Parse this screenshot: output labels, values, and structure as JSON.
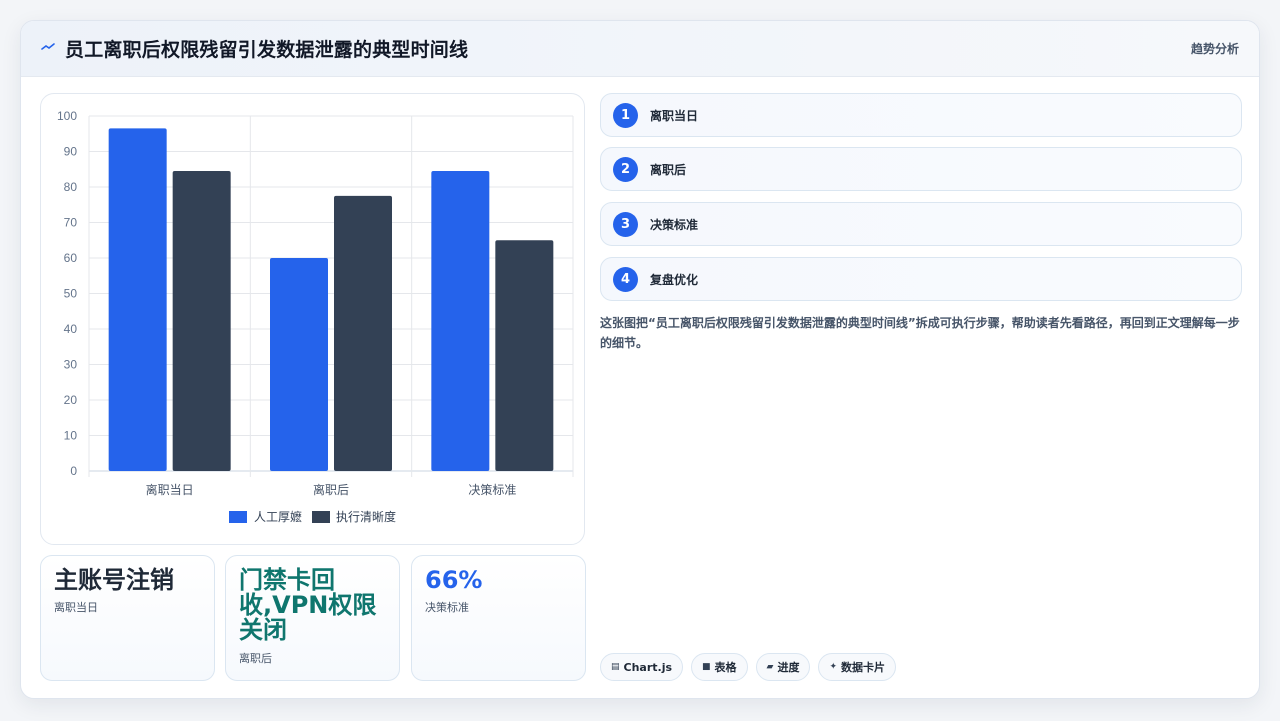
{
  "header": {
    "icon": "trend-line-icon",
    "title": "员工离职后权限残留引发数据泄露的典型时间线",
    "action_label": "趋势分析"
  },
  "chart_data": {
    "type": "bar",
    "categories": [
      "离职当日",
      "离职后",
      "决策标准"
    ],
    "series": [
      {
        "name": "人工厚嬷",
        "color": "#2563eb",
        "values": [
          96.5,
          60,
          84.5
        ]
      },
      {
        "name": "执行清晰度",
        "color": "#334155",
        "values": [
          84.5,
          77.5,
          65
        ]
      }
    ],
    "ylim": [
      0,
      100
    ],
    "yticks": [
      0,
      10,
      20,
      30,
      40,
      50,
      60,
      70,
      80,
      90,
      100
    ],
    "grid": true,
    "legend_position": "bottom"
  },
  "stats": [
    {
      "value": "主账号注销",
      "label": "离职当日",
      "color": "#1f2937"
    },
    {
      "value": "门禁卡回收,VPN权限关闭",
      "label": "离职后",
      "color": "#0f766e"
    },
    {
      "value": "66%",
      "label": "决策标准",
      "color": "#2563eb"
    }
  ],
  "steps": [
    {
      "num": "1",
      "label": "离职当日"
    },
    {
      "num": "2",
      "label": "离职后"
    },
    {
      "num": "3",
      "label": "决策标准"
    },
    {
      "num": "4",
      "label": "复盘优化"
    }
  ],
  "description": "这张图把“员工离职后权限残留引发数据泄露的典型时间线”拆成可执行步骤，帮助读者先看路径，再回到正文理解每一步的细节。",
  "tags": [
    {
      "icon": "▤",
      "label": "Chart.js"
    },
    {
      "icon": "■",
      "label": "表格"
    },
    {
      "icon": "▰",
      "label": "进度"
    },
    {
      "icon": "✦",
      "label": "数据卡片"
    }
  ]
}
